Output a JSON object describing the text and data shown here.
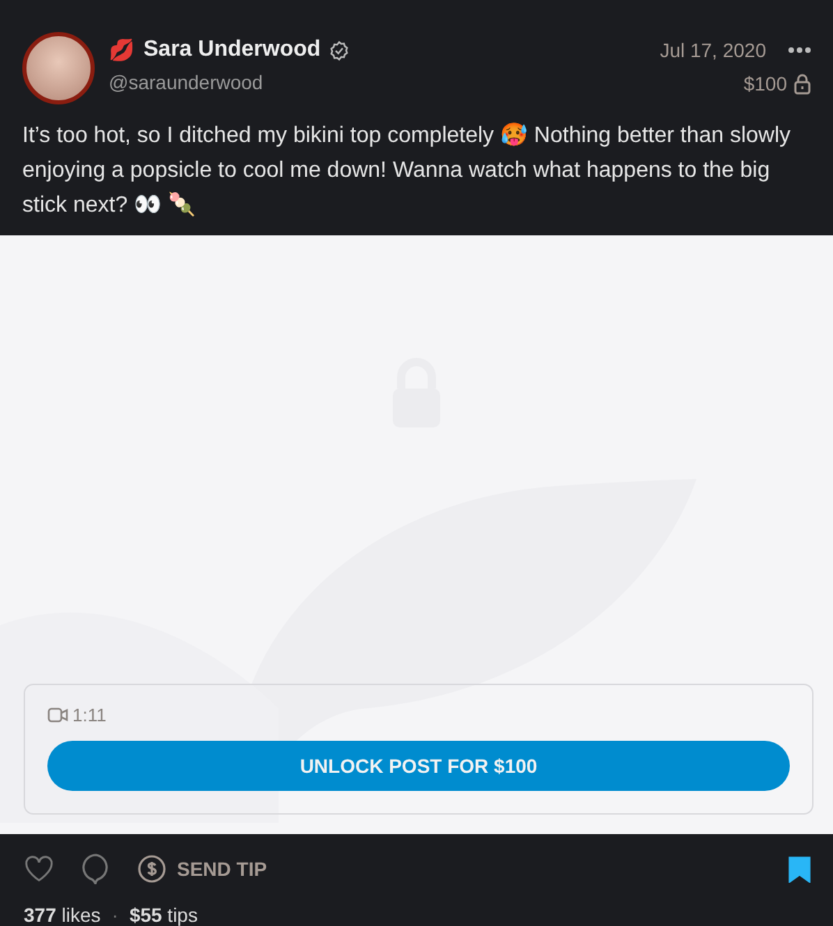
{
  "author": {
    "emoji": "💋",
    "name": "Sara Underwood",
    "verified": true,
    "handle": "@saraunderwood"
  },
  "date": "Jul 17, 2020",
  "price": "$100",
  "locked": true,
  "text": "It’s too hot, so I ditched my bikini top completely 🥵 Nothing better than slowly enjoying a popsicle to cool me down! Wanna watch what happens to the big stick next? 👀 🍡",
  "media": {
    "duration": "1:11",
    "unlock_button": "UNLOCK POST FOR $100"
  },
  "actions": {
    "send_tip": "SEND TIP",
    "bookmarked": true
  },
  "stats": {
    "likes": "**377** likes",
    "separator": "·",
    "tips": "**$55** tips"
  }
}
